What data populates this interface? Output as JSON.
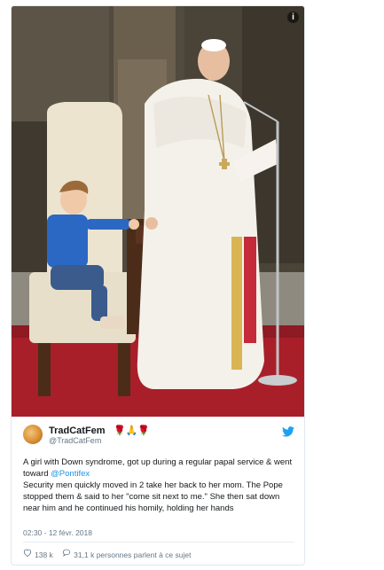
{
  "tweet": {
    "user": {
      "name": "TradCatFem",
      "handle": "@TradCatFem",
      "emojis": "🌹🙏🌹"
    },
    "text_before_mention": "A girl with Down syndrome, got up during a regular papal service & went toward ",
    "mention": "@Pontifex",
    "text_after_mention": "Security men quickly moved in 2 take her back to her mom. The Pope stopped them & said to her \"come sit next to me.\" She then sat down near him and he continued his homily, holding her hands",
    "timestamp": "02:30 - 12 févr. 2018",
    "likes": "138 k",
    "talking_about": "31,1 k personnes parlent à ce sujet"
  },
  "colors": {
    "twitter_blue": "#1da1f2",
    "link_blue": "#1b95e0",
    "muted": "#657786"
  },
  "icons": [
    "info-icon",
    "twitter-logo-icon",
    "heart-icon",
    "comment-icon"
  ]
}
